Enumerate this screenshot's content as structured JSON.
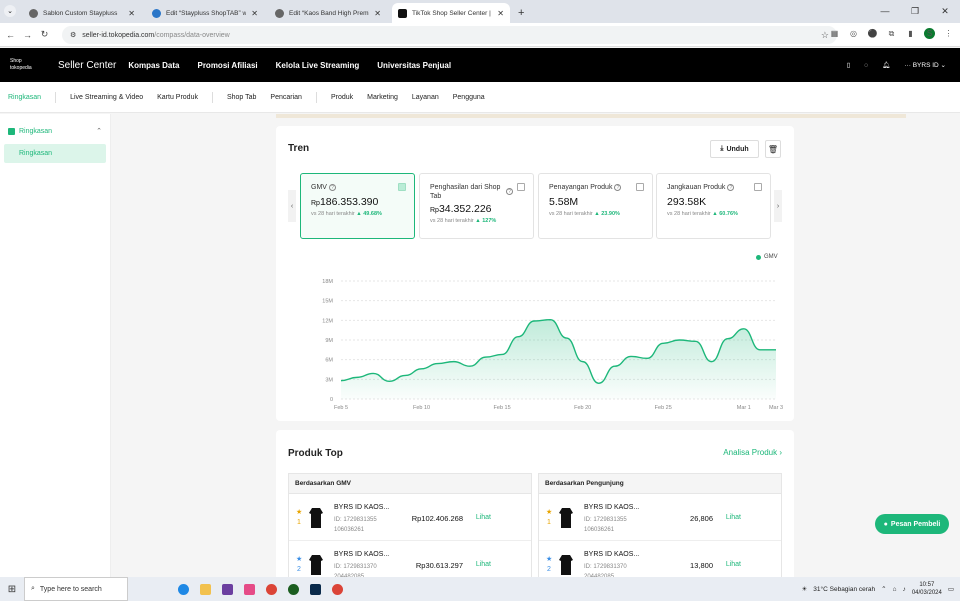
{
  "browser": {
    "tabs": [
      {
        "title": "Sablon Custom Staypluss",
        "active": false
      },
      {
        "title": "Edit “Staypluss ShopTAB” with E",
        "active": false
      },
      {
        "title": "Edit “Kaos Band High Premium",
        "active": false
      },
      {
        "title": "TikTok Shop Seller Center | Indo",
        "active": true
      }
    ],
    "url_host": "seller-id.tokopedia.com",
    "url_path": "/compass/data-overview",
    "profile_initial": "S"
  },
  "topnav": {
    "logo_line1": "Shop",
    "logo_line2": "tokopedia",
    "title": "Seller Center",
    "items": [
      "Kompas Data",
      "Promosi Afiliasi",
      "Kelola Live Streaming",
      "Universitas Penjual"
    ],
    "store": "BYRS ID"
  },
  "subnav": [
    "Ringkasan",
    "Live Streaming & Video",
    "Kartu Produk",
    "Shop Tab",
    "Pencarian",
    "Produk",
    "Marketing",
    "Layanan",
    "Pengguna"
  ],
  "sidebar": {
    "section": "Ringkasan",
    "item": "Ringkasan"
  },
  "tren": {
    "title": "Tren",
    "download_label": "Unduh",
    "metrics": [
      {
        "label": "GMV",
        "prefix": "Rp",
        "value": "186.353.390",
        "compare": "vs 28 hari terakhir",
        "change": "49.68%",
        "selected": true
      },
      {
        "label": "Penghasilan dari Shop Tab",
        "prefix": "Rp",
        "value": "34.352.226",
        "compare": "vs 28 hari terakhir",
        "change": "127%",
        "selected": false
      },
      {
        "label": "Penayangan Produk",
        "prefix": "",
        "value": "5.58M",
        "compare": "vs 28 hari terakhir",
        "change": "23.90%",
        "selected": false
      },
      {
        "label": "Jangkauan Produk",
        "prefix": "",
        "value": "293.58K",
        "compare": "vs 28 hari terakhir",
        "change": "60.76%",
        "selected": false
      }
    ],
    "legend": "GMV",
    "accent": "#1db77a"
  },
  "chart_data": {
    "type": "area",
    "title": "",
    "xlabel": "",
    "ylabel": "",
    "x_ticks": [
      "Feb 5",
      "Feb 10",
      "Feb 15",
      "Feb 20",
      "Feb 25",
      "Mar 1",
      "Mar 3"
    ],
    "y_ticks": [
      "0",
      "3M",
      "6M",
      "9M",
      "12M",
      "15M",
      "18M"
    ],
    "ylim": [
      0,
      18000000
    ],
    "x": [
      "Feb 5",
      "Feb 6",
      "Feb 7",
      "Feb 8",
      "Feb 9",
      "Feb 10",
      "Feb 11",
      "Feb 12",
      "Feb 13",
      "Feb 14",
      "Feb 15",
      "Feb 16",
      "Feb 17",
      "Feb 18",
      "Feb 19",
      "Feb 20",
      "Feb 21",
      "Feb 22",
      "Feb 23",
      "Feb 24",
      "Feb 25",
      "Feb 26",
      "Feb 27",
      "Feb 28",
      "Feb 29",
      "Mar 1",
      "Mar 2",
      "Mar 3"
    ],
    "series": [
      {
        "name": "GMV",
        "values": [
          2800000,
          3300000,
          3900000,
          2700000,
          3600000,
          4600000,
          5400000,
          5700000,
          5000000,
          6400000,
          6800000,
          9500000,
          11900000,
          12100000,
          9300000,
          5700000,
          2400000,
          5000000,
          6500000,
          6200000,
          8500000,
          9000000,
          8800000,
          5700000,
          9200000,
          10700000,
          7500000,
          7500000
        ]
      }
    ],
    "grid": true,
    "legend_position": "top-right"
  },
  "produk": {
    "title": "Produk Top",
    "analisa": "Analisa Produk",
    "tables": [
      {
        "header": "Berdasarkan GMV",
        "rows": [
          {
            "rank": "1",
            "name": "BYRS ID KAOS...",
            "id1": "ID: 1729831355",
            "id2": "106036261",
            "value": "Rp102.406.268",
            "action": "Lihat"
          },
          {
            "rank": "2",
            "name": "BYRS ID KAOS...",
            "id1": "ID: 1729831370",
            "id2": "204482085",
            "value": "Rp30.613.297",
            "action": "Lihat"
          }
        ]
      },
      {
        "header": "Berdasarkan Pengunjung",
        "rows": [
          {
            "rank": "1",
            "name": "BYRS ID KAOS...",
            "id1": "ID: 1729831355",
            "id2": "106036261",
            "value": "26,806",
            "action": "Lihat"
          },
          {
            "rank": "2",
            "name": "BYRS ID KAOS...",
            "id1": "ID: 1729831370",
            "id2": "204482085",
            "value": "13,800",
            "action": "Lihat"
          }
        ]
      }
    ]
  },
  "fab": "Pesan Pembeli",
  "taskbar": {
    "search_placeholder": "Type here to search",
    "weather": "31°C Sebagian cerah",
    "time": "10:57",
    "date": "04/03/2024",
    "notif": "5"
  }
}
